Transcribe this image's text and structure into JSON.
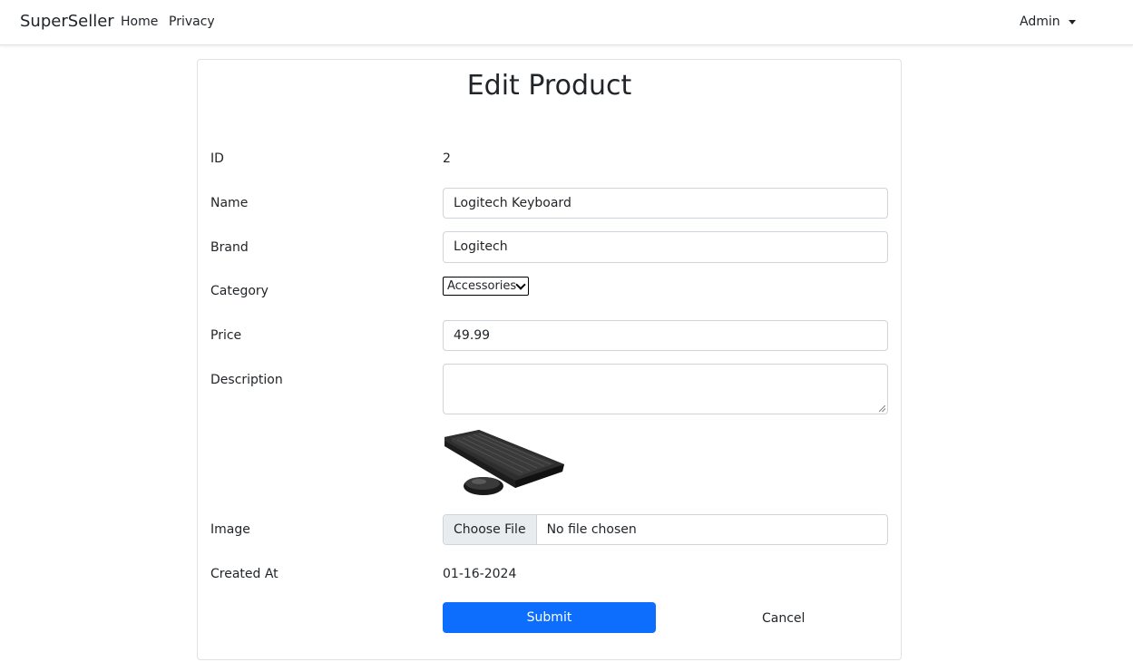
{
  "nav": {
    "brand": "SuperSeller",
    "links": [
      "Home",
      "Privacy"
    ],
    "user_menu": "Admin"
  },
  "form": {
    "title": "Edit Product",
    "labels": {
      "id": "ID",
      "name": "Name",
      "brand": "Brand",
      "category": "Category",
      "price": "Price",
      "description": "Description",
      "image": "Image",
      "created_at": "Created At"
    },
    "values": {
      "id": "2",
      "name": "Logitech Keyboard",
      "brand": "Logitech",
      "category": "Accessories",
      "price": "49.99",
      "description": "",
      "created_at": "01-16-2024"
    },
    "file": {
      "button": "Choose File",
      "status": "No file chosen"
    },
    "submit": "Submit",
    "cancel": "Cancel"
  },
  "colors": {
    "primary": "#0d6efd",
    "border": "#ced4da",
    "card_border": "#dee2e6"
  },
  "icons": {
    "user_menu": "caret-down-icon",
    "category_select": "chevron-down-icon"
  }
}
